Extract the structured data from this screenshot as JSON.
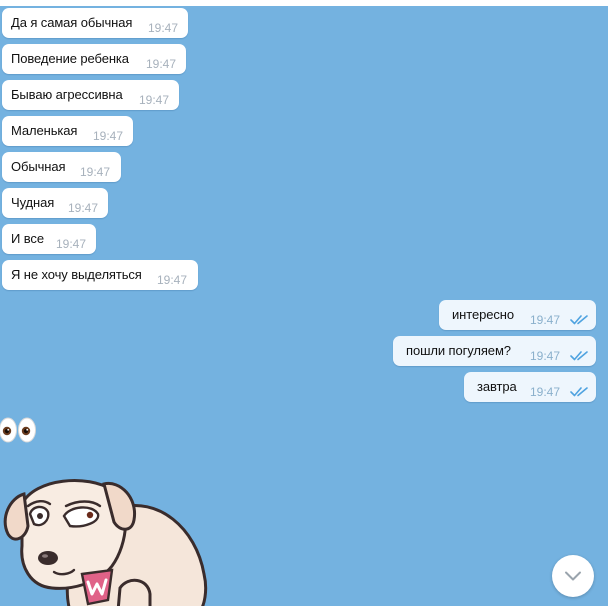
{
  "incoming_messages": [
    {
      "text": "Да я самая обычная",
      "time": "19:47"
    },
    {
      "text": "Поведение ребенка",
      "time": "19:47"
    },
    {
      "text": "Бываю агрессивна",
      "time": "19:47"
    },
    {
      "text": "Маленькая",
      "time": "19:47"
    },
    {
      "text": "Обычная",
      "time": "19:47"
    },
    {
      "text": "Чудная",
      "time": "19:47"
    },
    {
      "text": "И все",
      "time": "19:47"
    },
    {
      "text": "Я не хочу выделяться",
      "time": "19:47"
    }
  ],
  "outgoing_messages": [
    {
      "text": "интересно",
      "time": "19:47",
      "status": "read"
    },
    {
      "text": "пошли погуляем?",
      "time": "19:47",
      "status": "read"
    },
    {
      "text": "завтра",
      "time": "19:47",
      "status": "read"
    }
  ],
  "colors": {
    "chat_background": "#74b2e0",
    "incoming_bubble": "#ffffff",
    "outgoing_bubble": "#eef6fd",
    "read_check": "#4fa3e0"
  },
  "icons": {
    "read_receipt": "double-check-icon",
    "scroll_down": "chevron-down-icon",
    "emoji": "eyes-emoji",
    "sticker": "dog-sticker"
  }
}
